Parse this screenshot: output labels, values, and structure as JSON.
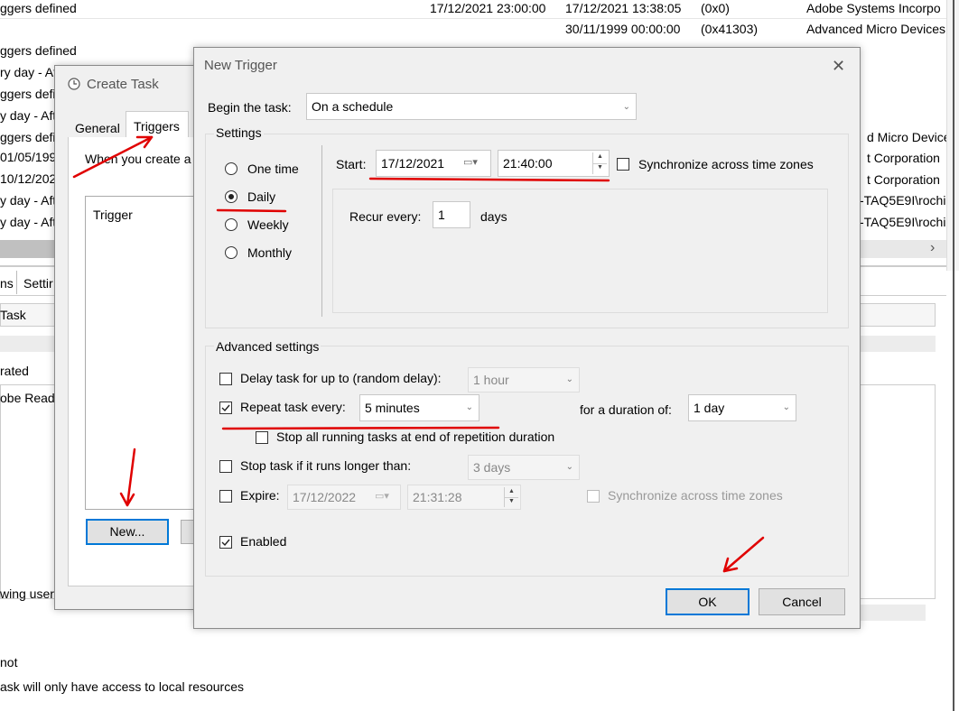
{
  "background": {
    "rows": [
      {
        "left": "ggers defined",
        "c1": "17/12/2021 23:00:00",
        "c2": "17/12/2021 13:38:05",
        "c3": "(0x0)",
        "c4": "Adobe Systems Incorpo"
      },
      {
        "left": "",
        "c1": "",
        "c2": "30/11/1999 00:00:00",
        "c3": "(0x41303)",
        "c4": "Advanced Micro Devices"
      },
      {
        "left": "ggers defined"
      },
      {
        "left": "ry day - Af"
      },
      {
        "left": "ggers defi"
      },
      {
        "left": "y day - Aft"
      },
      {
        "left": "ggers defi",
        "c4": "d Micro Devices"
      },
      {
        "left": "01/05/199",
        "c4": "t Corporation"
      },
      {
        "left": "10/12/202",
        "c4": "t Corporation"
      },
      {
        "left": "y day - Aft",
        "c4": "-TAQ5E9I\\rochi"
      },
      {
        "left": "y day - Aft",
        "c4": "-TAQ5E9I\\rochi"
      }
    ],
    "tab_a": "ns",
    "tab_b": "Settir",
    "task_label": "Task",
    "rated": "rated",
    "obe_read": "obe Read",
    "wing_user": "wing user",
    "not": "not",
    "bottom_text": "ask will only have access to local resources",
    "scroll_right": "›"
  },
  "create_task": {
    "title": "Create Task",
    "tabs": [
      "General",
      "Triggers"
    ],
    "intro_text": "When you create a",
    "list_header": "Trigger",
    "new_button": "New..."
  },
  "new_trigger": {
    "title": "New Trigger",
    "close_glyph": "✕",
    "begin_label": "Begin the task:",
    "begin_value": "On a schedule",
    "settings_label": "Settings",
    "radios": [
      {
        "label": "One time",
        "selected": false
      },
      {
        "label": "Daily",
        "selected": true
      },
      {
        "label": "Weekly",
        "selected": false
      },
      {
        "label": "Monthly",
        "selected": false
      }
    ],
    "start_label": "Start:",
    "start_date": "17/12/2021",
    "start_time": "21:40:00",
    "sync_label": "Synchronize across time zones",
    "recur_label": "Recur every:",
    "recur_value": "1",
    "recur_unit": "days",
    "advanced_label": "Advanced settings",
    "delay_label": "Delay task for up to (random delay):",
    "delay_value": "1 hour",
    "delay_checked": false,
    "repeat_label": "Repeat task every:",
    "repeat_value": "5 minutes",
    "repeat_checked": true,
    "duration_label": "for a duration of:",
    "duration_value": "1 day",
    "stop_running_label": "Stop all running tasks at end of repetition duration",
    "stop_longer_label": "Stop task if it runs longer than:",
    "stop_longer_value": "3 days",
    "expire_label": "Expire:",
    "expire_date": "17/12/2022",
    "expire_time": "21:31:28",
    "expire_sync_label": "Synchronize across time zones",
    "enabled_label": "Enabled",
    "enabled_checked": true,
    "ok_label": "OK",
    "cancel_label": "Cancel"
  },
  "colors": {
    "annotation": "#e00000",
    "accent": "#0078d7"
  }
}
